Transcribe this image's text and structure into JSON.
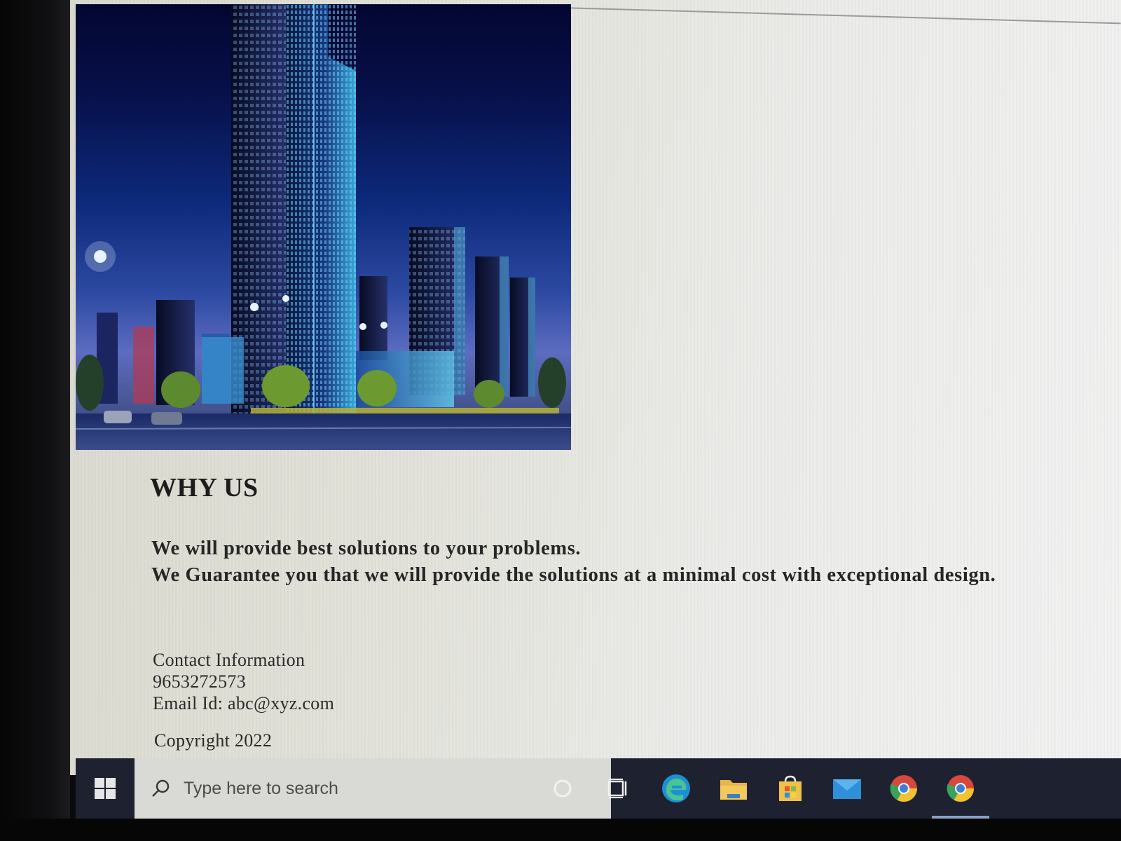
{
  "page": {
    "hero_image_alt": "night city skyline with illuminated skyscrapers",
    "why_us": {
      "title": "WHY US",
      "lines": [
        "We will provide best solutions to your problems.",
        "We Guarantee you that we will provide the solutions at a minimal cost with exceptional design."
      ]
    },
    "contact": {
      "heading": "Contact Information",
      "phone": "9653272573",
      "email": "Email Id: abc@xyz.com"
    },
    "copyright": "Copyright 2022"
  },
  "taskbar": {
    "search_placeholder": "Type here to search",
    "icons": [
      "windows-start-icon",
      "search-icon",
      "cortana-icon",
      "task-view-icon",
      "edge-icon",
      "file-explorer-icon",
      "microsoft-store-icon",
      "mail-icon",
      "chrome-icon",
      "chrome-icon"
    ],
    "colors": {
      "taskbar": "#1e2230",
      "search_box": "#d9d9d5",
      "edge": "#1e8fd6",
      "folder": "#e8b54a",
      "store": "#f0c04a",
      "mail": "#2f8fd8",
      "chrome_red": "#d8473c",
      "chrome_green": "#3aa35a",
      "chrome_yellow": "#f2c230"
    }
  }
}
